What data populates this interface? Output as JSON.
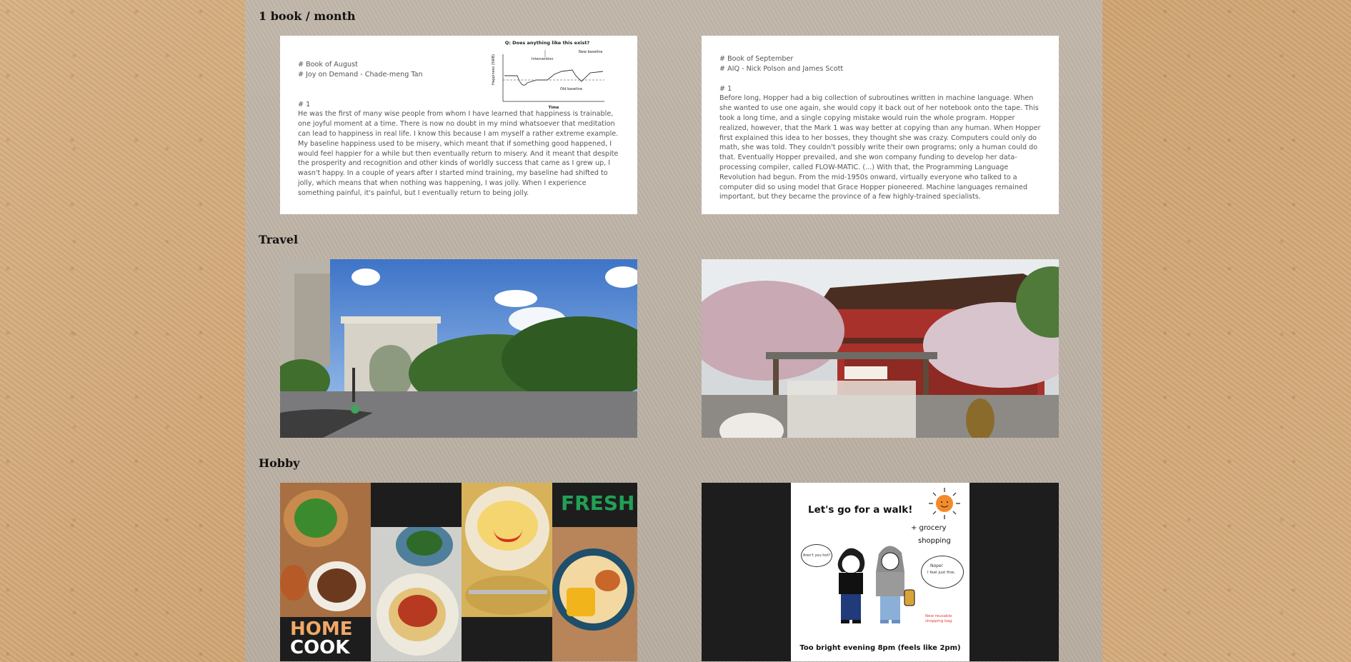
{
  "sections": {
    "book": {
      "heading": "1 book / month",
      "cards": [
        {
          "meta": "# Book of August\n# Joy on Demand - Chade-meng Tan",
          "number": "# 1",
          "text": "He was the first of many wise people from whom I have learned that happiness is trainable, one joyful moment at a time. There is now no doubt in my mind whatsoever that meditation can lead to happiness in real life. I know this because I am myself a rather extreme example. My baseline happiness used to be misery, which meant that if something good happened, I would feel happier for a while but then eventually return to misery. And it meant that despite the prosperity and recognition and other kinds of worldly success that came as I grew up, I wasn't happy. In a couple of years after I started mind training, my baseline had shifted to jolly, which means that when nothing was happening, I was jolly. When I experience something painful, it's painful, but I eventually return to being jolly.",
          "graph": {
            "question": "Q: Does anything like this exist?",
            "y_label": "Happiness (SWB)",
            "x_label": "Time",
            "labels": [
              "Intervention",
              "New baseline",
              "Old baseline"
            ]
          }
        },
        {
          "meta": "# Book of September\n# AIQ - Nick Polson and James Scott",
          "number": "# 1",
          "text": "Before long, Hopper had a big collection of subroutines written in machine language. When she wanted to use one again, she would copy it back out of her notebook onto the tape. This took a long time, and a single copying mistake would ruin the whole program. Hopper realized, however, that the Mark 1 was way better at copying than any human. When Hopper first explained this idea to her bosses, they thought she was crazy. Computers could only do math, she was told. They couldn't possibly write their own programs; only a human could do that. Eventually Hopper prevailed, and she won company funding to develop her data-processing compiler, called FLOW-MATIC. (...) With that, the Programming Language Revolution had begun. From the mid-1950s onward, virtually everyone who talked to a computer did so using model that Grace Hopper pioneered. Machine languages remained important, but they became the province of a few highly-trained specialists."
        }
      ]
    },
    "travel": {
      "heading": "Travel",
      "photos": [
        {
          "icon": "washington-square-arch-photo"
        },
        {
          "icon": "japanese-shrine-plum-blossom-photo"
        }
      ]
    },
    "hobby": {
      "heading": "Hobby",
      "collage": {
        "fresh": "FRESH",
        "home": "HOME",
        "cook": "COOK"
      },
      "walk": {
        "title": "Let's go for a walk!",
        "plus": "+ grocery",
        "plus2": "shopping",
        "bubble_left": "Aren't you hot?",
        "bubble_right_1": "Nope!",
        "bubble_right_2": "I feel just fine.",
        "bag_note_1": "New reusable",
        "bag_note_2": "shopping bag",
        "caption": "Too bright evening 8pm (feels like 2pm)"
      }
    }
  },
  "colors": {
    "page_bg": "#d2a877",
    "column_bg": "#bfb5a8",
    "fresh_green": "#22a055",
    "home_orange": "#f0a868"
  }
}
